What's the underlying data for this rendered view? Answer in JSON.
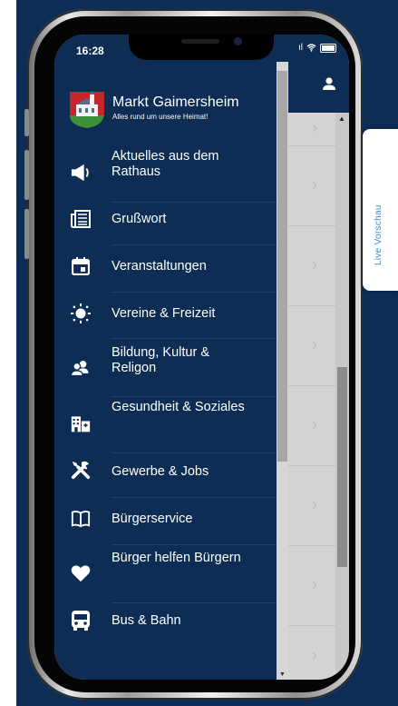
{
  "status_bar": {
    "time": "16:28",
    "signal": "ıl"
  },
  "app": {
    "title": "Markt Gaimersheim",
    "subtitle": "Alles rund um unsere Heimat!"
  },
  "menu": [
    {
      "label": "Aktuelles aus dem Rathaus",
      "icon": "megaphone-icon"
    },
    {
      "label": "Grußwort",
      "icon": "newspaper-icon"
    },
    {
      "label": "Veranstaltungen",
      "icon": "calendar-icon"
    },
    {
      "label": "Vereine & Freizeit",
      "icon": "sun-icon"
    },
    {
      "label": "Bildung, Kultur & Religon",
      "icon": "people-icon"
    },
    {
      "label": "Gesundheit & Soziales",
      "icon": "buildings-icon"
    },
    {
      "label": "Gewerbe & Jobs",
      "icon": "tools-icon"
    },
    {
      "label": "Bürgerservice",
      "icon": "book-icon"
    },
    {
      "label": "Bürger helfen Bürgern",
      "icon": "heart-icon"
    },
    {
      "label": "Bus & Bahn",
      "icon": "bus-icon"
    }
  ],
  "live_preview": {
    "label": "Live Vorschau"
  },
  "colors": {
    "navy": "#0d2d55",
    "accent": "#2f8fdf"
  }
}
